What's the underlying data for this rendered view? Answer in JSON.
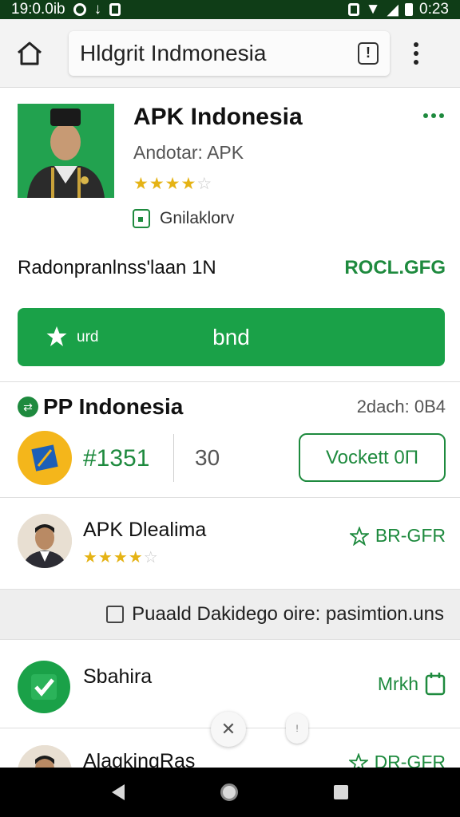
{
  "status_bar": {
    "left_text": "19:0.0ib",
    "time": "0:23"
  },
  "browser": {
    "url_text": "Hldgrit Indmonesia",
    "info_icon": "!"
  },
  "app": {
    "title": "APK Indonesia",
    "subtitle": "Andotar: APK",
    "rating": 3.5,
    "rating_max": 5,
    "category": "Gnilaklorv"
  },
  "info_row": {
    "left": "Radonpranlnss'laan 1N",
    "right": "ROCL.GFG"
  },
  "install": {
    "small_label": "urd",
    "label": "bnd"
  },
  "section": {
    "title": "PP Indonesia",
    "meta": "2dach: 0B4"
  },
  "stats": {
    "value": "#1351",
    "count": "30",
    "button_label": "Vockett 0Π"
  },
  "items": [
    {
      "title": "APK Dlealima",
      "right_label": "BR-GFR",
      "rating": 4,
      "rating_max": 5
    },
    {
      "title": "Sbahira",
      "right_label": "Mrkh"
    },
    {
      "title": "AlagkingRas",
      "right_label": "DR-GFR"
    }
  ],
  "promo": {
    "text": "Puaald Dakidego oire: pasimtion.uns"
  },
  "colors": {
    "accent": "#1aa148",
    "dark_green": "#0f3d17",
    "star": "#e5b315",
    "coin": "#f4b61b"
  }
}
